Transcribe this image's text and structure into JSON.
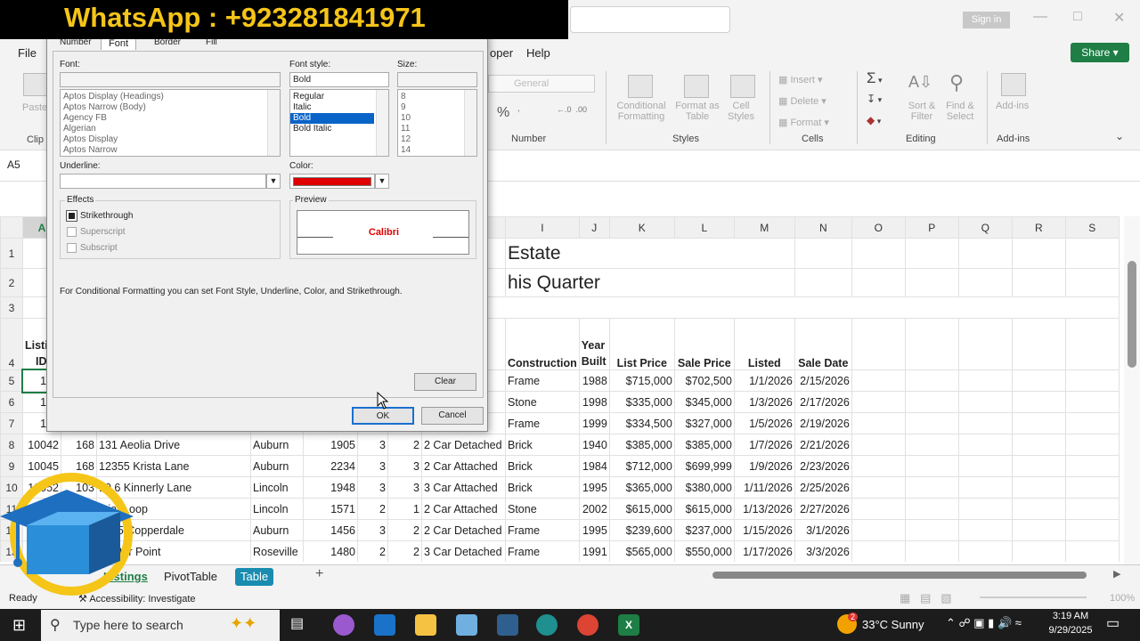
{
  "watermark": "WhatsApp : +923281841971",
  "titlebar": {
    "signin": "Sign in"
  },
  "menu": {
    "file": "File",
    "developer": "oper",
    "help": "Help",
    "share": "Share"
  },
  "ribbon": {
    "paste": "Paste",
    "clip": "Clip",
    "number_format": "General",
    "number_label": "Number",
    "cond_fmt": "Conditional Formatting",
    "format_table": "Format as Table",
    "cell_styles": "Cell Styles",
    "styles_label": "Styles",
    "insert": "Insert",
    "delete": "Delete",
    "format": "Format",
    "cells_label": "Cells",
    "sort_filter": "Sort & Filter",
    "find_select": "Find & Select",
    "editing_label": "Editing",
    "addins": "Add-ins",
    "addins_label": "Add-ins"
  },
  "namebox": "A5",
  "columns": [
    "A",
    "B",
    "C",
    "D",
    "E",
    "F",
    "G",
    "H",
    "I",
    "J",
    "K",
    "L",
    "M",
    "N",
    "O",
    "P",
    "Q",
    "R",
    "S"
  ],
  "sheet": {
    "title1": "Estate",
    "title2": "his Quarter",
    "headers": {
      "a4a": "Listi",
      "a4b": "ID",
      "construction": "Construction",
      "year_a": "Year",
      "year_b": "Built",
      "list_price": "List Price",
      "sale_price": "Sale Price",
      "listed": "Listed",
      "sale_date": "Sale Date"
    },
    "rows": [
      {
        "r": "5",
        "a": "100",
        "h": "ed",
        "i": "Frame",
        "j": "1988",
        "k": "$715,000",
        "l": "$702,500",
        "m": "1/1/2026",
        "n": "2/15/2026"
      },
      {
        "r": "6",
        "a": "100",
        "h": "ed",
        "i": "Stone",
        "j": "1998",
        "k": "$335,000",
        "l": "$345,000",
        "m": "1/3/2026",
        "n": "2/17/2026"
      },
      {
        "r": "7",
        "a": "100",
        "h": "ed",
        "i": "Frame",
        "j": "1999",
        "k": "$334,500",
        "l": "$327,000",
        "m": "1/5/2026",
        "n": "2/19/2026"
      },
      {
        "r": "8",
        "a": "10042",
        "b": "168",
        "c": "131 Aeolia Drive",
        "d": "Auburn",
        "e": "1905",
        "f": "3",
        "g": "2",
        "h": "2 Car Detached",
        "i": "Brick",
        "j": "1940",
        "k": "$385,000",
        "l": "$385,000",
        "m": "1/7/2026",
        "n": "2/21/2026"
      },
      {
        "r": "9",
        "a": "10045",
        "b": "168",
        "c": "12355 Krista Lane",
        "d": "Auburn",
        "e": "2234",
        "f": "3",
        "g": "3",
        "h": "2 Car Attached",
        "i": "Brick",
        "j": "1984",
        "k": "$712,000",
        "l": "$699,999",
        "m": "1/9/2026",
        "n": "2/23/2026"
      },
      {
        "r": "10",
        "a": "10052",
        "b": "103",
        "c": "10 6 Kinnerly Lane",
        "d": "Lincoln",
        "e": "1948",
        "f": "3",
        "g": "3",
        "h": "3 Car Attached",
        "i": "Brick",
        "j": "1995",
        "k": "$365,000",
        "l": "$380,000",
        "m": "1/11/2026",
        "n": "2/25/2026"
      },
      {
        "r": "11",
        "a": "",
        "b": "",
        "c": "...iat Loop",
        "d": "Lincoln",
        "e": "1571",
        "f": "2",
        "g": "1",
        "h": "2 Car Attached",
        "i": "Stone",
        "j": "2002",
        "k": "$615,000",
        "l": "$615,000",
        "m": "1/13/2026",
        "n": "2/27/2026"
      },
      {
        "r": "12",
        "a": "1006",
        "b": "",
        "c": "1235 Copperdale",
        "d": "Auburn",
        "e": "1456",
        "f": "3",
        "g": "2",
        "h": "2 Car Detached",
        "i": "Frame",
        "j": "1995",
        "k": "$239,600",
        "l": "$237,000",
        "m": "1/15/2026",
        "n": "3/1/2026"
      },
      {
        "r": "13",
        "a": "1",
        "b": "",
        "c": "Center Point",
        "d": "Roseville",
        "e": "1480",
        "f": "2",
        "g": "2",
        "h": "3 Car Detached",
        "i": "Frame",
        "j": "1991",
        "k": "$565,000",
        "l": "$550,000",
        "m": "1/17/2026",
        "n": "3/3/2026"
      }
    ]
  },
  "sheet_tabs": [
    "Listings",
    "PivotTable",
    "Table"
  ],
  "status": {
    "ready": "Ready",
    "accessibility": "Accessibility: Investigate",
    "zoom": "100%"
  },
  "taskbar": {
    "search": "Type here to search",
    "weather": "33°C  Sunny",
    "time": "3:19 AM",
    "date": "9/29/2025",
    "badge": "2"
  },
  "dialog": {
    "tabs": [
      "Number",
      "Font",
      "Border",
      "Fill"
    ],
    "font_label": "Font:",
    "font_value": "",
    "fonts": [
      "Aptos Display (Headings)",
      "Aptos Narrow (Body)",
      "Agency FB",
      "Algerian",
      "Aptos Display",
      "Aptos Narrow"
    ],
    "style_label": "Font style:",
    "style_value": "Bold",
    "styles": [
      "Regular",
      "Italic",
      "Bold",
      "Bold Italic"
    ],
    "size_label": "Size:",
    "size_value": "",
    "sizes": [
      "8",
      "9",
      "10",
      "11",
      "12",
      "14"
    ],
    "underline_label": "Underline:",
    "color_label": "Color:",
    "color_value": "#e00000",
    "effects_label": "Effects",
    "strike": "Strikethrough",
    "super": "Superscript",
    "sub": "Subscript",
    "preview_label": "Preview",
    "preview_text": "Calibri",
    "note": "For Conditional Formatting you can set Font Style, Underline, Color, and Strikethrough.",
    "clear": "Clear",
    "ok": "OK",
    "cancel": "Cancel"
  }
}
